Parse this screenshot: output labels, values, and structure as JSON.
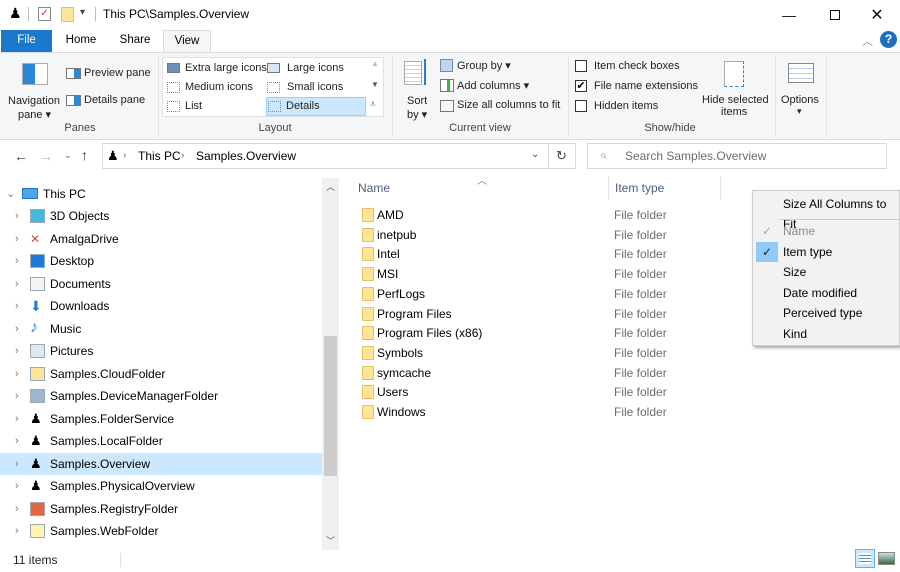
{
  "window": {
    "title": "This PC\\Samples.Overview",
    "minimize_icon": "minimize-icon",
    "maximize_icon": "maximize-icon",
    "close_icon": "close-icon"
  },
  "tabs": [
    {
      "label": "File"
    },
    {
      "label": "Home"
    },
    {
      "label": "Share"
    },
    {
      "label": "View"
    }
  ],
  "ribbon": {
    "panes": {
      "navigation_pane_label": "Navigation",
      "navigation_pane_label2": "pane",
      "preview_pane": "Preview pane",
      "details_pane": "Details pane",
      "group_label": "Panes"
    },
    "layout": {
      "options": [
        "Extra large icons",
        "Large icons",
        "Medium icons",
        "Small icons",
        "List",
        "Details"
      ],
      "selected": "Details",
      "group_label": "Layout"
    },
    "current_view": {
      "sort_label": "Sort",
      "sort_label2": "by",
      "group_by": "Group by",
      "add_columns": "Add columns",
      "size_all_columns": "Size all columns to fit",
      "group_label": "Current view"
    },
    "show_hide": {
      "item_check_boxes": {
        "label": "Item check boxes",
        "checked": false
      },
      "file_name_extensions": {
        "label": "File name extensions",
        "checked": true
      },
      "hidden_items": {
        "label": "Hidden items",
        "checked": false
      },
      "hide_selected_label": "Hide selected",
      "hide_selected_label2": "items",
      "group_label": "Show/hide"
    },
    "options_label": "Options"
  },
  "address": {
    "breadcrumb": [
      "This PC",
      "Samples.Overview"
    ],
    "search_placeholder": "Search Samples.Overview"
  },
  "nav_pane": {
    "root": "This PC",
    "items": [
      {
        "label": "3D Objects",
        "icon": "3d-objects-icon"
      },
      {
        "label": "AmalgaDrive",
        "icon": "amalgadrive-icon"
      },
      {
        "label": "Desktop",
        "icon": "desktop-icon"
      },
      {
        "label": "Documents",
        "icon": "documents-icon"
      },
      {
        "label": "Downloads",
        "icon": "downloads-icon"
      },
      {
        "label": "Music",
        "icon": "music-icon"
      },
      {
        "label": "Pictures",
        "icon": "pictures-icon"
      },
      {
        "label": "Samples.CloudFolder",
        "icon": "cloud-folder-icon"
      },
      {
        "label": "Samples.DeviceManagerFolder",
        "icon": "device-manager-icon"
      },
      {
        "label": "Samples.FolderService",
        "icon": "sample-shell-icon"
      },
      {
        "label": "Samples.LocalFolder",
        "icon": "sample-shell-icon"
      },
      {
        "label": "Samples.Overview",
        "icon": "sample-shell-icon",
        "selected": true
      },
      {
        "label": "Samples.PhysicalOverview",
        "icon": "sample-shell-icon"
      },
      {
        "label": "Samples.RegistryFolder",
        "icon": "registry-icon"
      },
      {
        "label": "Samples.WebFolder",
        "icon": "web-folder-icon"
      }
    ]
  },
  "file_list": {
    "columns": [
      "Name",
      "Item type"
    ],
    "rows": [
      {
        "name": "AMD",
        "type": "File folder"
      },
      {
        "name": "inetpub",
        "type": "File folder"
      },
      {
        "name": "Intel",
        "type": "File folder"
      },
      {
        "name": "MSI",
        "type": "File folder"
      },
      {
        "name": "PerfLogs",
        "type": "File folder"
      },
      {
        "name": "Program Files",
        "type": "File folder"
      },
      {
        "name": "Program Files (x86)",
        "type": "File folder"
      },
      {
        "name": "Symbols",
        "type": "File folder"
      },
      {
        "name": "symcache",
        "type": "File folder"
      },
      {
        "name": "Users",
        "type": "File folder"
      },
      {
        "name": "Windows",
        "type": "File folder"
      }
    ]
  },
  "context_menu": {
    "header": "Size All Columns to Fit",
    "items": [
      {
        "label": "Name",
        "checked": true,
        "disabled": true
      },
      {
        "label": "Item type",
        "checked": true,
        "highlighted": true
      },
      {
        "label": "Size",
        "checked": false
      },
      {
        "label": "Date modified",
        "checked": false
      },
      {
        "label": "Perceived type",
        "checked": false
      },
      {
        "label": "Kind",
        "checked": false
      }
    ]
  },
  "status": {
    "item_count": "11 items"
  },
  "colors": {
    "accent": "#1979ca",
    "selection": "#cce8ff",
    "folder": "#ffe59a"
  }
}
